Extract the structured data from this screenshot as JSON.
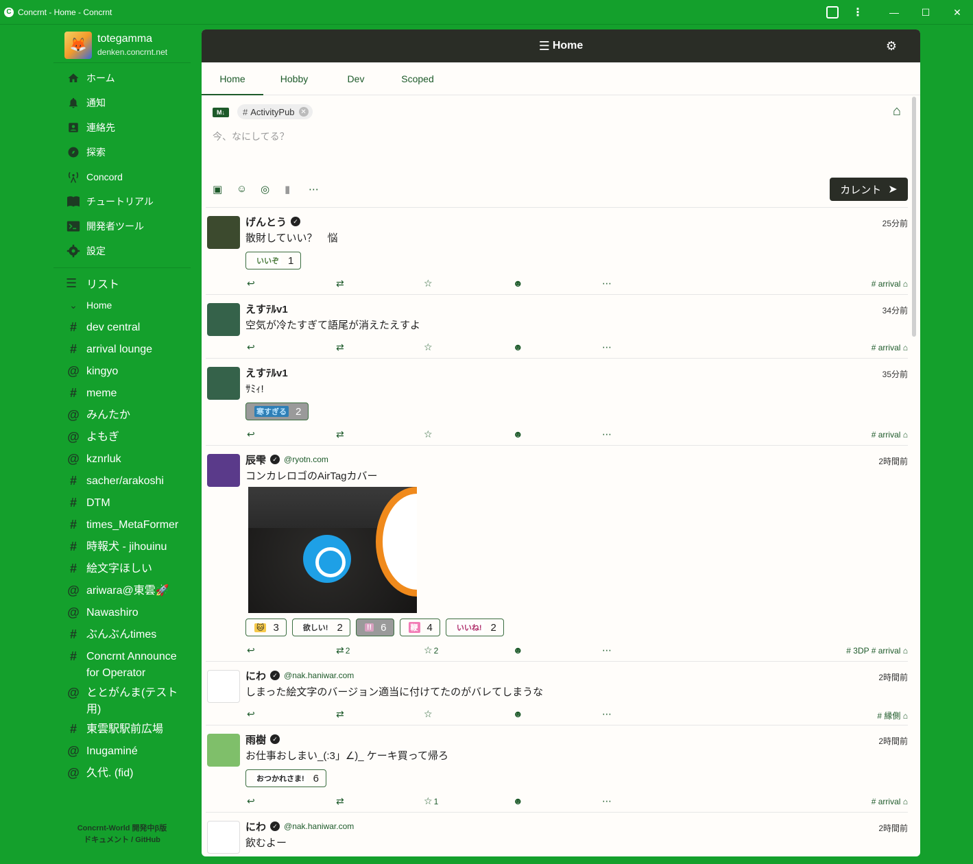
{
  "window": {
    "title": "Concrnt - Home - Concrnt",
    "controls": [
      "—",
      "☐",
      "✕"
    ]
  },
  "profile": {
    "username": "totegamma",
    "host": "denken.concrnt.net"
  },
  "nav": [
    {
      "label": "ホーム",
      "icon": "home-icon"
    },
    {
      "label": "通知",
      "icon": "bell-icon"
    },
    {
      "label": "連絡先",
      "icon": "contacts-icon"
    },
    {
      "label": "探索",
      "icon": "compass-icon"
    },
    {
      "label": "Concord",
      "icon": "antenna-icon"
    },
    {
      "label": "チュートリアル",
      "icon": "book-icon"
    },
    {
      "label": "開発者ツール",
      "icon": "terminal-icon"
    },
    {
      "label": "設定",
      "icon": "gear-icon"
    }
  ],
  "lists": {
    "heading": "リスト",
    "current": "Home",
    "streams": [
      {
        "prefix": "#",
        "label": "dev central"
      },
      {
        "prefix": "#",
        "label": "arrival lounge"
      },
      {
        "prefix": "@",
        "label": "kingyo"
      },
      {
        "prefix": "#",
        "label": "meme"
      },
      {
        "prefix": "@",
        "label": "みんたか"
      },
      {
        "prefix": "@",
        "label": "よもぎ"
      },
      {
        "prefix": "@",
        "label": "kznrluk"
      },
      {
        "prefix": "#",
        "label": "sacher/arakoshi"
      },
      {
        "prefix": "#",
        "label": "DTM"
      },
      {
        "prefix": "#",
        "label": "times_MetaFormer"
      },
      {
        "prefix": "#",
        "label": "時報犬 - jihouinu"
      },
      {
        "prefix": "#",
        "label": "絵文字ほしい"
      },
      {
        "prefix": "@",
        "label": "ariwara@東雲🚀"
      },
      {
        "prefix": "@",
        "label": "Nawashiro"
      },
      {
        "prefix": "#",
        "label": "ぶんぶんtimes"
      },
      {
        "prefix": "#",
        "label": "Concrnt Announce for Operator"
      },
      {
        "prefix": "@",
        "label": "ととがんま(テスト用)"
      },
      {
        "prefix": "#",
        "label": "東雲駅駅前広場"
      },
      {
        "prefix": "@",
        "label": "Inugaminé"
      },
      {
        "prefix": "@",
        "label": "久代. (fid)"
      }
    ]
  },
  "footer": {
    "line1": "Concrnt-World 開発中β版",
    "line2": "ドキュメント / GitHub"
  },
  "header": {
    "title": "Home"
  },
  "tabs": [
    "Home",
    "Hobby",
    "Dev",
    "Scoped"
  ],
  "composer": {
    "md_badge": "M↓",
    "chip": "ActivityPub",
    "placeholder": "今、なにしてる？",
    "send_label": "カレント"
  },
  "posts": [
    {
      "name": "げんとう",
      "verified": true,
      "handle": "",
      "time": "25分前",
      "text": "散財していい？　悩",
      "reactions": [
        {
          "emoji": "いいぞ",
          "count": "1",
          "sel": false,
          "bg": "#ffffff",
          "fg": "#4a7a3a"
        }
      ],
      "counts": {
        "reply": "",
        "repost": "",
        "fav": ""
      },
      "tags": "# arrival ⌂",
      "avatar_color": "#3c4a2e"
    },
    {
      "name": "えすﾃﾙv1",
      "verified": false,
      "handle": "",
      "time": "34分前",
      "text": "空気が冷たすぎて語尾が消えたえすよ",
      "reactions": [],
      "counts": {
        "reply": "",
        "repost": "",
        "fav": ""
      },
      "tags": "# arrival ⌂",
      "avatar_color": "#35624a"
    },
    {
      "name": "えすﾃﾙv1",
      "verified": false,
      "handle": "",
      "time": "35分前",
      "text": "ｻﾐｨ!",
      "reactions": [
        {
          "emoji": "寒すぎる",
          "count": "2",
          "sel": true,
          "bg": "#2e7fb6",
          "fg": "#bfe6ff"
        }
      ],
      "counts": {
        "reply": "",
        "repost": "",
        "fav": ""
      },
      "tags": "# arrival ⌂",
      "avatar_color": "#35624a"
    },
    {
      "name": "辰雫",
      "verified": true,
      "handle": "@ryotn.com",
      "time": "2時間前",
      "text": "コンカレロゴのAirTagカバー",
      "reactions": [
        {
          "emoji": "🐱",
          "count": "3",
          "sel": false,
          "bg": "#f6c94a",
          "fg": "#222"
        },
        {
          "emoji": "欲しい!",
          "count": "2",
          "sel": false,
          "bg": "#ffffff",
          "fg": "#333"
        },
        {
          "emoji": "!!",
          "count": "6",
          "sel": true,
          "bg": "#d9a0c0",
          "fg": "#fff"
        },
        {
          "emoji": "鞭",
          "count": "4",
          "sel": false,
          "bg": "#f27cb6",
          "fg": "#fff"
        },
        {
          "emoji": "いいね!",
          "count": "2",
          "sel": false,
          "bg": "#ffffff",
          "fg": "#b0306a"
        }
      ],
      "counts": {
        "reply": "",
        "repost": "2",
        "fav": "2"
      },
      "tags": "# 3DP # arrival ⌂",
      "avatar_color": "#5a3a8a"
    },
    {
      "name": "にわ",
      "verified": true,
      "handle": "@nak.haniwar.com",
      "time": "2時間前",
      "text": "しまった絵文字のバージョン適当に付けてたのがバレてしまうな",
      "reactions": [],
      "counts": {
        "reply": "",
        "repost": "",
        "fav": ""
      },
      "tags": "# 縁側 ⌂",
      "avatar_color": "#ffffff"
    },
    {
      "name": "雨樹",
      "verified": true,
      "handle": "",
      "time": "2時間前",
      "text": "お仕事おしまい_(:3」∠)_ ケーキ買って帰ろ",
      "reactions": [
        {
          "emoji": "おつかれさま!",
          "count": "6",
          "sel": false,
          "bg": "#ffffff",
          "fg": "#222"
        }
      ],
      "counts": {
        "reply": "",
        "repost": "",
        "fav": "1"
      },
      "tags": "# arrival ⌂",
      "avatar_color": "#7fbf6a"
    },
    {
      "name": "にわ",
      "verified": true,
      "handle": "@nak.haniwar.com",
      "time": "2時間前",
      "text": "飲むよー",
      "reactions": [],
      "counts": {
        "reply": "",
        "repost": "",
        "fav": ""
      },
      "tags": "",
      "avatar_color": "#ffffff"
    }
  ]
}
